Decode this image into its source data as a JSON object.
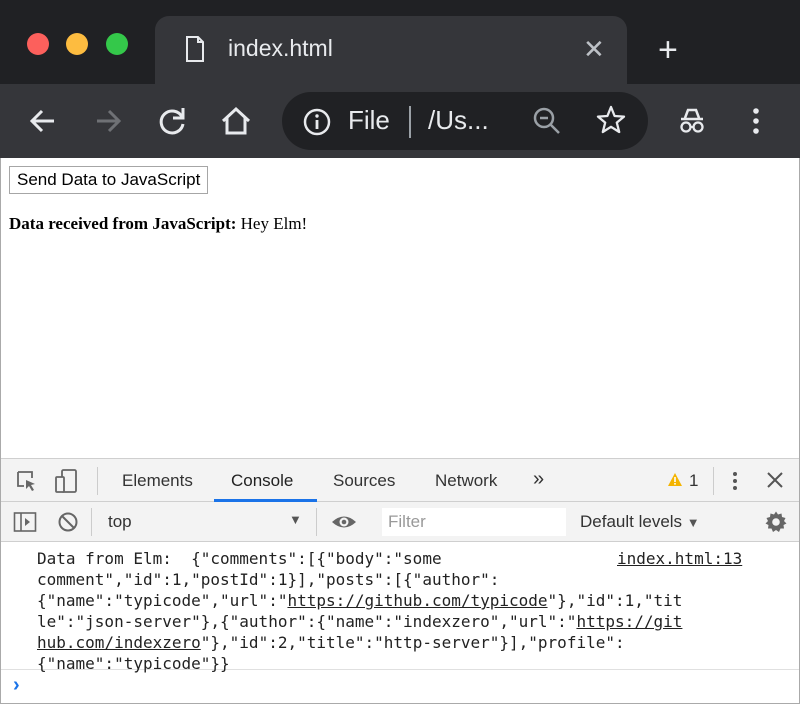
{
  "browser": {
    "tab_title": "index.html",
    "omnibox": {
      "scheme_label": "File",
      "url": "/Us..."
    },
    "icons": [
      "back-icon",
      "forward-icon",
      "reload-icon",
      "home-icon",
      "info-icon",
      "zoom-icon",
      "star-icon",
      "incognito-icon",
      "menu-icon"
    ]
  },
  "page": {
    "send_button_label": "Send Data to JavaScript",
    "received_label": "Data received from JavaScript:",
    "received_value": " Hey Elm!"
  },
  "devtools": {
    "tabs": [
      "Elements",
      "Console",
      "Sources",
      "Network"
    ],
    "more_tabs": "»",
    "active_tab": "Console",
    "warning_count": "1",
    "context": "top",
    "filter_placeholder": "Filter",
    "levels": "Default levels",
    "console": {
      "line1_a": "Data from Elm:  {\"comments\":[{\"body\":\"some",
      "line2": "comment\",\"id\":1,\"postId\":1}],\"posts\":[{\"author\":",
      "line3_a": "{\"name\":\"typicode\",\"url\":\"",
      "line3_link": "https://github.com/typicode",
      "line3_b": "\"},\"id\":1,\"tit",
      "line4_a": "le\":\"json-server\"},{\"author\":{\"name\":\"indexzero\",\"url\":\"",
      "line4_link": "https://git",
      "line5_link": "hub.com/indexzero",
      "line5_b": "\"},\"id\":2,\"title\":\"http-server\"}],\"profile\":",
      "line6": "{\"name\":\"typicode\"}}",
      "source": "index.html:13"
    },
    "prompt_symbol": "›"
  },
  "colors": {
    "accent": "#1a73e8",
    "warning": "#f4b400",
    "chrome_dark": "#202124",
    "chrome_toolbar": "#35363a"
  }
}
